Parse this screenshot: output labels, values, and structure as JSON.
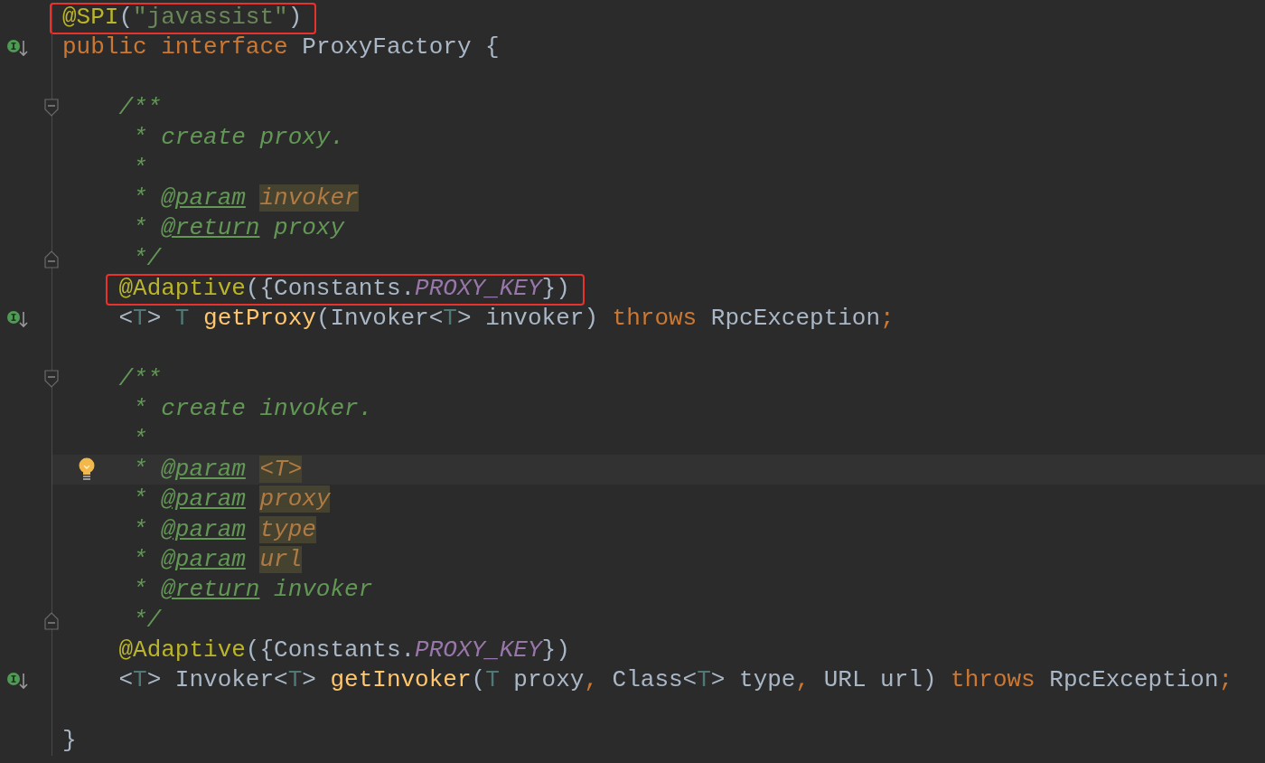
{
  "lines": [
    {
      "boxed": true,
      "tokens": [
        {
          "text": "@SPI",
          "kind": "annotation"
        },
        {
          "text": "(",
          "kind": "plain"
        },
        {
          "text": "\"javassist\"",
          "kind": "string"
        },
        {
          "text": ")",
          "kind": "plain"
        }
      ]
    },
    {
      "implemented": true,
      "tokens": [
        {
          "text": "public",
          "kind": "keyword"
        },
        {
          "text": " interface",
          "kind": "keyword"
        },
        {
          "text": " ProxyFactory {",
          "kind": "plain"
        }
      ]
    },
    {
      "space_before": true,
      "fold_start": true,
      "tokens": [
        {
          "text": "    /**",
          "kind": "comment"
        }
      ]
    },
    {
      "tokens": [
        {
          "text": "     * create proxy.",
          "kind": "comment"
        }
      ]
    },
    {
      "tokens": [
        {
          "text": "     *",
          "kind": "comment"
        }
      ]
    },
    {
      "tokens": [
        {
          "text": "     * ",
          "kind": "comment"
        },
        {
          "text": "@param",
          "kind": "doctag"
        },
        {
          "text": " invoker",
          "kind": "docref"
        }
      ]
    },
    {
      "tokens": [
        {
          "text": "     * ",
          "kind": "comment"
        },
        {
          "text": "@return",
          "kind": "doctag"
        },
        {
          "text": " proxy",
          "kind": "comment"
        }
      ]
    },
    {
      "fold_end": true,
      "tokens": [
        {
          "text": "     */",
          "kind": "comment"
        }
      ]
    },
    {
      "boxed": true,
      "tokens": [
        {
          "text": "    @Adaptive",
          "kind": "annotation"
        },
        {
          "text": "({Constants.",
          "kind": "plain"
        },
        {
          "text": "PROXY_KEY",
          "kind": "constant"
        },
        {
          "text": "})",
          "kind": "plain"
        }
      ]
    },
    {
      "implemented": true,
      "tokens": [
        {
          "text": "    <",
          "kind": "plain"
        },
        {
          "text": "T",
          "kind": "typeparam"
        },
        {
          "text": "> ",
          "kind": "plain"
        },
        {
          "text": "T",
          "kind": "typeparam"
        },
        {
          "text": " getProxy",
          "kind": "method"
        },
        {
          "text": "(Invoker<",
          "kind": "plain"
        },
        {
          "text": "T",
          "kind": "typeparam"
        },
        {
          "text": "> invoker) ",
          "kind": "plain"
        },
        {
          "text": "throws",
          "kind": "keyword"
        },
        {
          "text": " RpcException",
          "kind": "plain"
        },
        {
          "text": ";",
          "kind": "keyword"
        }
      ]
    },
    {
      "space_before": true,
      "fold_start": true,
      "tokens": [
        {
          "text": "    /**",
          "kind": "comment"
        }
      ]
    },
    {
      "tokens": [
        {
          "text": "     * create invoker.",
          "kind": "comment"
        }
      ]
    },
    {
      "tokens": [
        {
          "text": "     *",
          "kind": "comment"
        }
      ]
    },
    {
      "caret": true,
      "bulb": true,
      "tokens": [
        {
          "text": "     * ",
          "kind": "comment"
        },
        {
          "text": "@param",
          "kind": "doctag"
        },
        {
          "text": " <T>",
          "kind": "docref"
        }
      ]
    },
    {
      "tokens": [
        {
          "text": "     * ",
          "kind": "comment"
        },
        {
          "text": "@param",
          "kind": "doctag"
        },
        {
          "text": " proxy",
          "kind": "docref"
        }
      ]
    },
    {
      "tokens": [
        {
          "text": "     * ",
          "kind": "comment"
        },
        {
          "text": "@param",
          "kind": "doctag"
        },
        {
          "text": " type",
          "kind": "docref"
        }
      ]
    },
    {
      "tokens": [
        {
          "text": "     * ",
          "kind": "comment"
        },
        {
          "text": "@param",
          "kind": "doctag"
        },
        {
          "text": " url",
          "kind": "docref"
        }
      ]
    },
    {
      "tokens": [
        {
          "text": "     * ",
          "kind": "comment"
        },
        {
          "text": "@return",
          "kind": "doctag"
        },
        {
          "text": " invoker",
          "kind": "comment"
        }
      ]
    },
    {
      "fold_end": true,
      "tokens": [
        {
          "text": "     */",
          "kind": "comment"
        }
      ]
    },
    {
      "tokens": [
        {
          "text": "    @Adaptive",
          "kind": "annotation"
        },
        {
          "text": "({Constants.",
          "kind": "plain"
        },
        {
          "text": "PROXY_KEY",
          "kind": "constant"
        },
        {
          "text": "})",
          "kind": "plain"
        }
      ]
    },
    {
      "implemented": true,
      "tokens": [
        {
          "text": "    <",
          "kind": "plain"
        },
        {
          "text": "T",
          "kind": "typeparam"
        },
        {
          "text": "> Invoker<",
          "kind": "plain"
        },
        {
          "text": "T",
          "kind": "typeparam"
        },
        {
          "text": "> ",
          "kind": "plain"
        },
        {
          "text": "getInvoker",
          "kind": "method"
        },
        {
          "text": "(",
          "kind": "plain"
        },
        {
          "text": "T",
          "kind": "typeparam"
        },
        {
          "text": " proxy",
          "kind": "plain"
        },
        {
          "text": ",",
          "kind": "keyword"
        },
        {
          "text": " Class<",
          "kind": "plain"
        },
        {
          "text": "T",
          "kind": "typeparam"
        },
        {
          "text": "> type",
          "kind": "plain"
        },
        {
          "text": ",",
          "kind": "keyword"
        },
        {
          "text": " URL url) ",
          "kind": "plain"
        },
        {
          "text": "throws",
          "kind": "keyword"
        },
        {
          "text": " RpcException",
          "kind": "plain"
        },
        {
          "text": ";",
          "kind": "keyword"
        }
      ]
    },
    {
      "space_before": true,
      "tokens": [
        {
          "text": "}",
          "kind": "plain"
        }
      ]
    }
  ]
}
